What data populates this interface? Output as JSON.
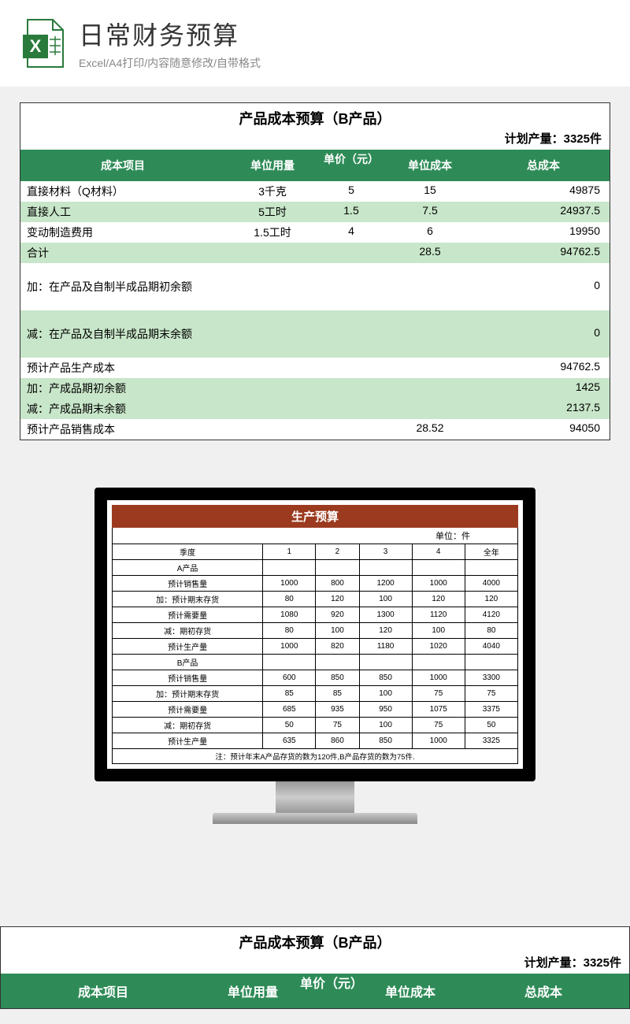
{
  "header": {
    "title": "日常财务预算",
    "subtitle": "Excel/A4打印/内容随意修改/自带格式"
  },
  "sheet1": {
    "title": "产品成本预算（B产品）",
    "plan_label": "计划产量：3325件",
    "headers": {
      "c1": "成本项目",
      "c2": "单位用量",
      "c3": "单价（元）",
      "c4": "单位成本",
      "c5": "总成本"
    },
    "rows": [
      {
        "c1": "直接材料（Q材料）",
        "c2": "3千克",
        "c3": "5",
        "c4": "15",
        "c5": "49875",
        "cls": ""
      },
      {
        "c1": "直接人工",
        "c2": "5工时",
        "c3": "1.5",
        "c4": "7.5",
        "c5": "24937.5",
        "cls": "lg"
      },
      {
        "c1": "变动制造费用",
        "c2": "1.5工时",
        "c3": "4",
        "c4": "6",
        "c5": "19950",
        "cls": ""
      },
      {
        "c1": "合计",
        "c2": "",
        "c3": "",
        "c4": "28.5",
        "c5": "94762.5",
        "cls": "lg"
      },
      {
        "c1": "加：在产品及自制半成品期初余额",
        "c2": "",
        "c3": "",
        "c4": "",
        "c5": "0",
        "cls": "tall"
      },
      {
        "c1": "减：在产品及自制半成品期末余额",
        "c2": "",
        "c3": "",
        "c4": "",
        "c5": "0",
        "cls": "lg tall"
      },
      {
        "c1": "预计产品生产成本",
        "c2": "",
        "c3": "",
        "c4": "",
        "c5": "94762.5",
        "cls": ""
      },
      {
        "c1": "加：产成品期初余额",
        "c2": "",
        "c3": "",
        "c4": "",
        "c5": "1425",
        "cls": "lg"
      },
      {
        "c1": "减：产成品期末余额",
        "c2": "",
        "c3": "",
        "c4": "",
        "c5": "2137.5",
        "cls": "lg"
      },
      {
        "c1": "预计产品销售成本",
        "c2": "",
        "c3": "",
        "c4": "28.52",
        "c5": "94050",
        "cls": ""
      }
    ]
  },
  "sheet2": {
    "title": "生产预算",
    "unit": "单位：件",
    "cols": [
      "季度",
      "1",
      "2",
      "3",
      "4",
      "全年"
    ],
    "sectionA": "A产品",
    "sectionB": "B产品",
    "rowsA": [
      {
        "l": "预计销售量",
        "v": [
          "1000",
          "800",
          "1200",
          "1000",
          "4000"
        ]
      },
      {
        "l": "加：预计期末存货",
        "v": [
          "80",
          "120",
          "100",
          "120",
          "120"
        ]
      },
      {
        "l": "预计需要量",
        "v": [
          "1080",
          "920",
          "1300",
          "1120",
          "4120"
        ]
      },
      {
        "l": "减：期初存货",
        "v": [
          "80",
          "100",
          "120",
          "100",
          "80"
        ]
      },
      {
        "l": "预计生产量",
        "v": [
          "1000",
          "820",
          "1180",
          "1020",
          "4040"
        ]
      }
    ],
    "rowsB": [
      {
        "l": "预计销售量",
        "v": [
          "600",
          "850",
          "850",
          "1000",
          "3300"
        ]
      },
      {
        "l": "加：预计期末存货",
        "v": [
          "85",
          "85",
          "100",
          "75",
          "75"
        ]
      },
      {
        "l": "预计需要量",
        "v": [
          "685",
          "935",
          "950",
          "1075",
          "3375"
        ]
      },
      {
        "l": "减：期初存货",
        "v": [
          "50",
          "75",
          "100",
          "75",
          "50"
        ]
      },
      {
        "l": "预计生产量",
        "v": [
          "635",
          "860",
          "850",
          "1000",
          "3325"
        ]
      }
    ],
    "note": "注：预计年末A产品存货的数为120件,B产品存货的数为75件."
  }
}
